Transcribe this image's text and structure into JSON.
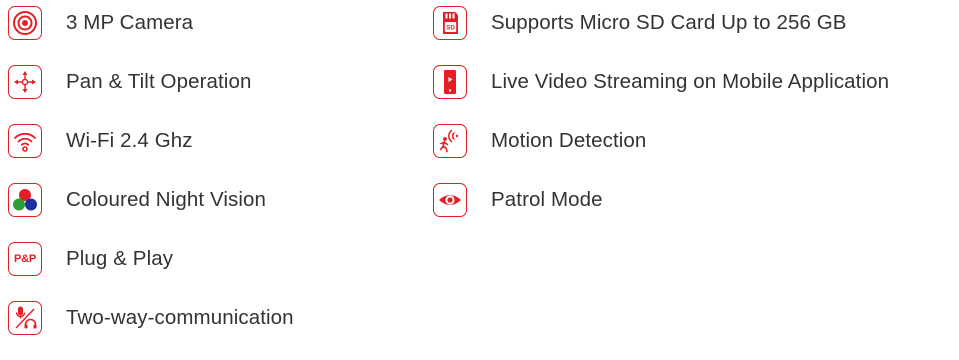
{
  "colors": {
    "accent": "#e31e24",
    "text": "#333333",
    "night_vision_green": "#2e9e3a",
    "night_vision_blue": "#1e2fa0"
  },
  "left_features": [
    {
      "label": "3 MP Camera",
      "icon": "camera-lens-icon"
    },
    {
      "label": "Pan & Tilt Operation",
      "icon": "pan-tilt-icon"
    },
    {
      "label": "Wi-Fi 2.4 Ghz",
      "icon": "wifi-icon"
    },
    {
      "label": "Coloured Night Vision",
      "icon": "color-circles-icon"
    },
    {
      "label": "Plug & Play",
      "icon": "plug-and-play-icon",
      "icon_text": "P&P"
    },
    {
      "label": "Two-way-communication",
      "icon": "mic-headphone-icon"
    }
  ],
  "right_features": [
    {
      "label": "Supports Micro SD Card Up to 256 GB",
      "icon": "sd-card-icon",
      "icon_text": "SD"
    },
    {
      "label": "Live Video Streaming on Mobile Application",
      "icon": "mobile-stream-icon"
    },
    {
      "label": "Motion Detection",
      "icon": "motion-detection-icon"
    },
    {
      "label": "Patrol Mode",
      "icon": "eye-icon"
    }
  ]
}
